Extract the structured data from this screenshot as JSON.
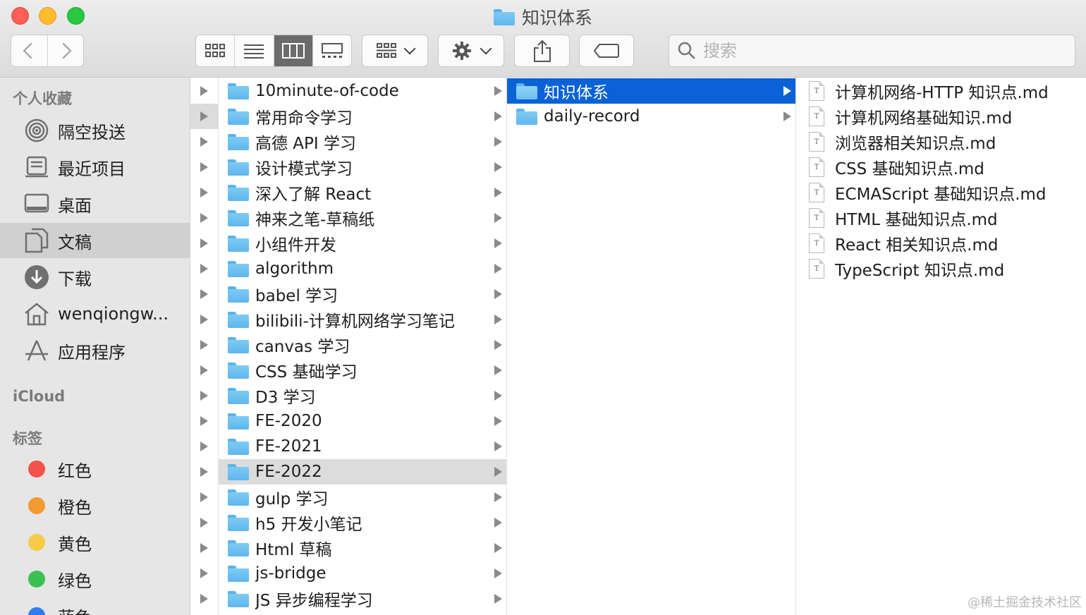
{
  "window": {
    "title": "知识体系"
  },
  "search": {
    "placeholder": "搜索"
  },
  "sidebar": {
    "favorites_header": "个人收藏",
    "favorites": [
      {
        "label": "隔空投送",
        "icon": "airdrop-icon"
      },
      {
        "label": "最近项目",
        "icon": "recents-icon"
      },
      {
        "label": "桌面",
        "icon": "desktop-icon"
      },
      {
        "label": "文稿",
        "icon": "documents-icon",
        "selected": true
      },
      {
        "label": "下载",
        "icon": "downloads-icon"
      },
      {
        "label": "wenqiongw...",
        "icon": "home-icon"
      },
      {
        "label": "应用程序",
        "icon": "applications-icon"
      }
    ],
    "icloud_header": "iCloud",
    "tags_header": "标签",
    "tags": [
      {
        "label": "红色",
        "color": "#f4524a"
      },
      {
        "label": "橙色",
        "color": "#f49a33"
      },
      {
        "label": "黄色",
        "color": "#f7cb45"
      },
      {
        "label": "绿色",
        "color": "#3cc150"
      },
      {
        "label": "蓝色",
        "color": "#2d7cf6"
      }
    ]
  },
  "column1": {
    "highlighted_row": 1
  },
  "column2": {
    "items": [
      "10minute-of-code",
      "常用命令学习",
      "高德 API 学习",
      "设计模式学习",
      "深入了解 React",
      "神来之笔-草稿纸",
      "小组件开发",
      "algorithm",
      "babel 学习",
      "bilibili-计算机网络学习笔记",
      "canvas 学习",
      "CSS 基础学习",
      "D3 学习",
      "FE-2020",
      "FE-2021",
      "FE-2022",
      "gulp 学习",
      "h5 开发小笔记",
      "Html 草稿",
      "js-bridge",
      "JS 异步编程学习"
    ],
    "highlighted": "FE-2022"
  },
  "column3": {
    "items": [
      "知识体系",
      "daily-record"
    ],
    "selected": "知识体系"
  },
  "column4": {
    "files": [
      "计算机网络-HTTP 知识点.md",
      "计算机网络基础知识.md",
      "浏览器相关知识点.md",
      "CSS 基础知识点.md",
      "ECMAScript 基础知识点.md",
      "HTML 基础知识点.md",
      "React 相关知识点.md",
      "TypeScript 知识点.md"
    ],
    "file_icon_glyph": "T"
  },
  "watermark": "@稀土掘金技术社区"
}
